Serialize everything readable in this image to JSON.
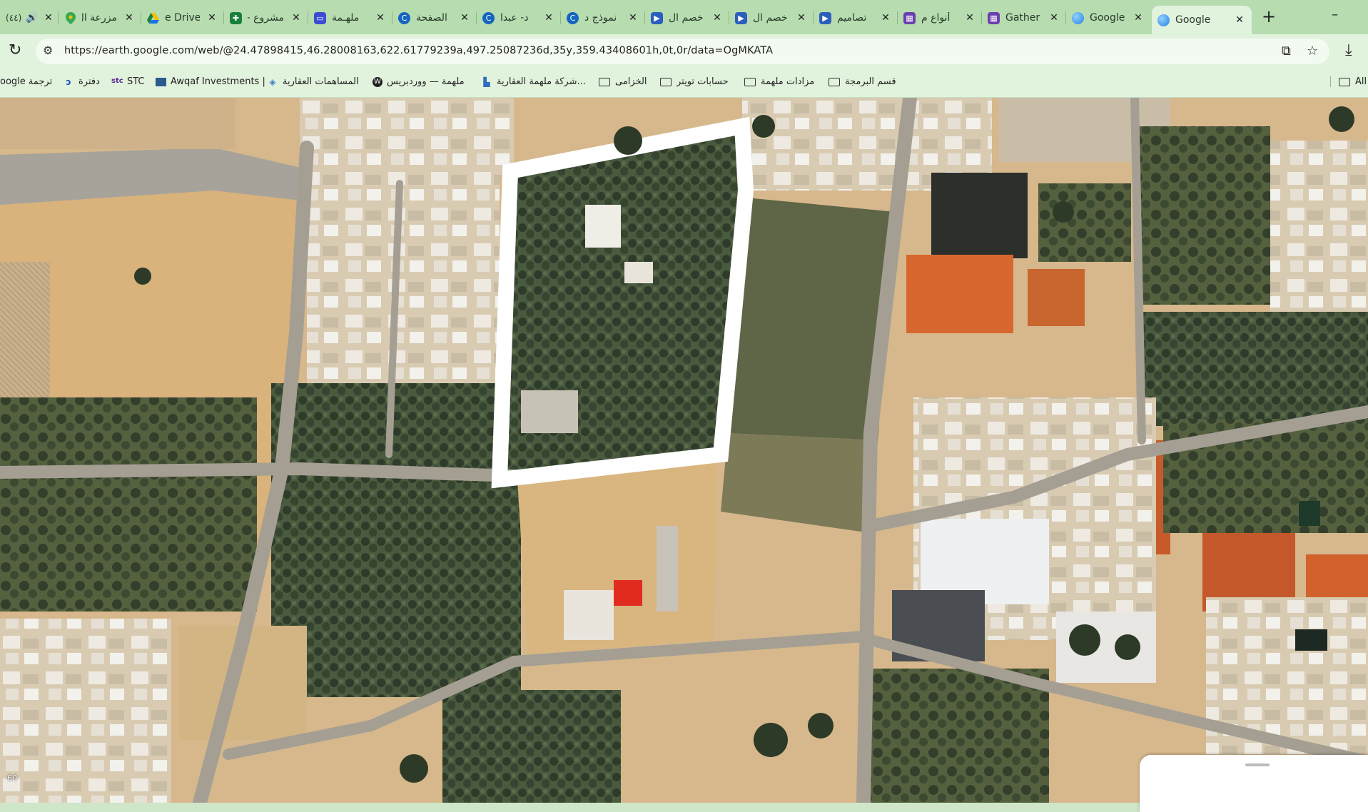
{
  "browser": {
    "tabs": [
      {
        "label": "(٤٤)",
        "icon": "speaker-icon",
        "color": "#2b3a2b"
      },
      {
        "label": "مزرعة ال",
        "icon": "maps-icon",
        "color": "#34a853"
      },
      {
        "label": "e Drive",
        "icon": "drive-icon",
        "color": "#1a73e8"
      },
      {
        "label": "مشروع -",
        "icon": "sheets-icon",
        "color": "#188038"
      },
      {
        "label": "ملهـمة",
        "icon": "printer-icon",
        "color": "#3c4bd6"
      },
      {
        "label": "الصفحة",
        "icon": "c-logo-icon",
        "color": "#1565c0"
      },
      {
        "label": "د- عبدا",
        "icon": "c-logo-icon",
        "color": "#1565c0"
      },
      {
        "label": "نموذج د",
        "icon": "c-logo-icon",
        "color": "#1565c0"
      },
      {
        "label": "خصم ال",
        "icon": "video-icon",
        "color": "#2c5ebd"
      },
      {
        "label": "خصم ال",
        "icon": "video-icon",
        "color": "#2c5ebd"
      },
      {
        "label": "تصاميم",
        "icon": "video-icon",
        "color": "#2c5ebd"
      },
      {
        "label": "أنواع م",
        "icon": "gather-icon",
        "color": "#6b3fb0"
      },
      {
        "label": "Gather",
        "icon": "gather-icon",
        "color": "#6b3fb0"
      },
      {
        "label": "Google",
        "icon": "earth-icon",
        "color": "#2a7de1"
      },
      {
        "label": "Google",
        "icon": "earth-icon",
        "color": "#2a7de1",
        "active": true
      }
    ],
    "new_tab": "+",
    "minimize": "–",
    "url": "https://earth.google.com/web/@24.47898415,46.28008163,622.61779239a,497.25087236d,35y,359.43408601h,0t,0r/data=OgMKATA",
    "bookmarks": [
      {
        "label": "oogle ترجمة",
        "icon": "none"
      },
      {
        "label": "دفترة",
        "icon": "daftra-icon"
      },
      {
        "label": "STC",
        "icon": "stc-icon"
      },
      {
        "label": "Awqaf Investments |",
        "icon": "awqaf-icon"
      },
      {
        "label": "المساهمات العقارية",
        "icon": "diamond-icon"
      },
      {
        "label": "ملهمة — ووردبريس",
        "icon": "wordpress-icon"
      },
      {
        "label": "شركة ملهمة العقارية...",
        "icon": "company-icon"
      },
      {
        "label": "الخزامى",
        "icon": "folder-icon"
      },
      {
        "label": "حسابات تويتر",
        "icon": "folder-icon"
      },
      {
        "label": "مزادات ملهمة",
        "icon": "folder-icon"
      },
      {
        "label": "قسم البرمجة",
        "icon": "folder-icon"
      },
      {
        "label": "All",
        "icon": "folder-icon"
      }
    ]
  },
  "map": {
    "type": "satellite",
    "scale_label": "60"
  },
  "colors": {
    "tabstrip": "#b6dcb0",
    "toolbar": "#e1f2dd",
    "boundary": "#ffffff",
    "vegetation": "#3b4a33",
    "sand": "#d8b98a",
    "red_soil": "#d8672f"
  }
}
